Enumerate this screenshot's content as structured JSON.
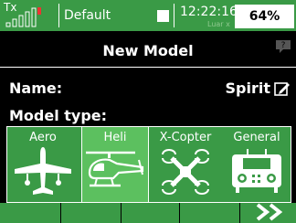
{
  "status": {
    "tx_label": "Tx",
    "profile": "Default",
    "time": "12:22:16",
    "lua_label": "Luar x",
    "battery": "64%"
  },
  "screen": {
    "title": "New Model",
    "name_label": "Name:",
    "name_value": "Spirit",
    "model_type_label": "Model type:"
  },
  "model_types": [
    {
      "label": "Aero",
      "icon": "airplane-icon"
    },
    {
      "label": "Heli",
      "icon": "helicopter-icon",
      "selected": true
    },
    {
      "label": "X-Copter",
      "icon": "quadcopter-icon"
    },
    {
      "label": "General",
      "icon": "controller-icon"
    }
  ],
  "colors": {
    "accent": "#3a9a46",
    "selected": "#5cc05f"
  }
}
